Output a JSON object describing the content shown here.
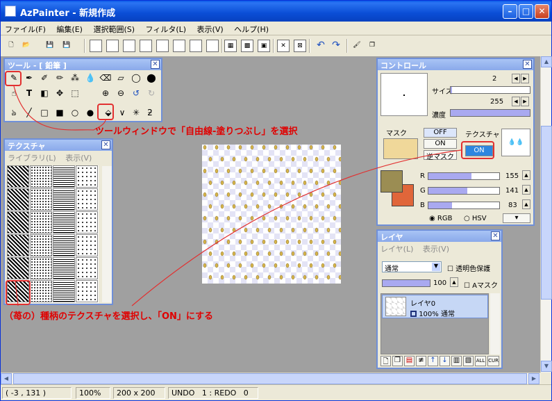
{
  "window": {
    "title": "AzPainter - 新規作成",
    "min_label": "–",
    "max_label": "□",
    "close_label": "✕"
  },
  "menu": [
    "ファイル(F)",
    "編集(E)",
    "選択範囲(S)",
    "フィルタ(L)",
    "表示(V)",
    "ヘルプ(H)"
  ],
  "toolbar": [
    "TE",
    "TL",
    "TC",
    "TF",
    "TH",
    "T",
    "TC",
    "TR",
    "grid",
    "grid2",
    "grid3",
    "X",
    "X2",
    "undo",
    "redo",
    "brush",
    "copy"
  ],
  "tool_panel": {
    "title": "ツール - [ 鉛筆 ]"
  },
  "texture_panel": {
    "title": "テクスチャ",
    "menu": [
      "ライブラリ(L)",
      "表示(V)"
    ]
  },
  "control_panel": {
    "title": "コントロール",
    "size_label": "サイズ",
    "size_value": "2",
    "density_label": "濃度",
    "density_value": "255",
    "mask_label": "マスク",
    "mask_off": "OFF",
    "mask_on": "ON",
    "mask_reverse": "逆マスク",
    "texture_label": "テクスチャ",
    "texture_on": "ON",
    "r_label": "R",
    "r_value": "155",
    "r_level": 0.61,
    "g_label": "G",
    "g_value": "141",
    "g_level": 0.55,
    "b_label": "B",
    "b_value": "83",
    "b_level": 0.33,
    "rgb_label": "RGB",
    "hsv_label": "HSV",
    "fg_color": "#9b8d53",
    "bg_color": "#e0663a"
  },
  "layer_panel": {
    "title": "レイヤ",
    "menu": [
      "レイヤ(L)",
      "表示(V)"
    ],
    "blend_mode": "通常",
    "transparency_lock": "透明色保護",
    "opacity_value": "100",
    "amask": "Aマスク",
    "layer_name": "レイヤ0",
    "layer_info": "100% 通常",
    "footer_all": "ALL",
    "footer_cur": "CUR"
  },
  "annotations": {
    "tool_note": "ツールウィンドウで「自由線-塗りつぶし」を選択",
    "texture_note": "（苺の）種柄のテクスチャを選択し、「ON」にする"
  },
  "status": {
    "coords": "( -3 , 131 )",
    "zoom": "100%",
    "size": "200 x 200",
    "undo": "UNDO   1 : REDO   0"
  },
  "colors": {
    "accent": "#e23030",
    "title": "#0a4ed6"
  }
}
